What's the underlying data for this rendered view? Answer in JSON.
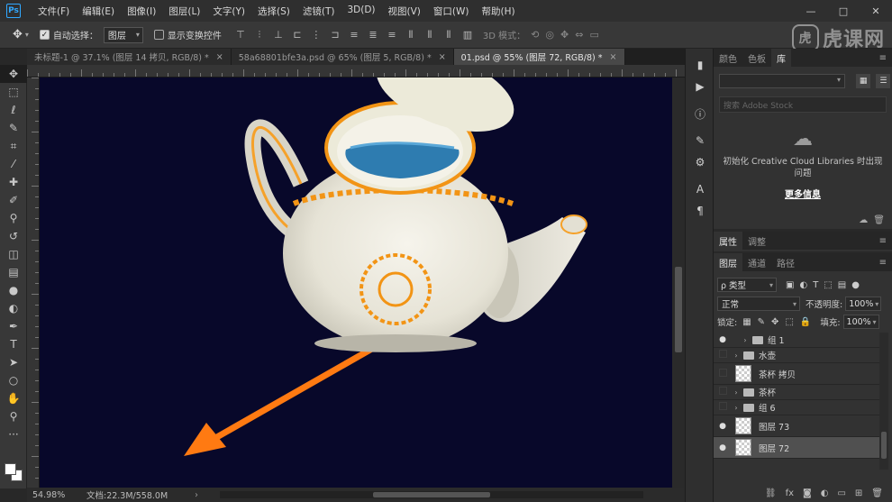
{
  "menu": {
    "logo": "Ps",
    "items": [
      "文件(F)",
      "编辑(E)",
      "图像(I)",
      "图层(L)",
      "文字(Y)",
      "选择(S)",
      "滤镜(T)",
      "3D(D)",
      "视图(V)",
      "窗口(W)",
      "帮助(H)"
    ],
    "window_buttons": [
      "—",
      "□",
      "✕"
    ]
  },
  "options": {
    "auto_select_label": "自动选择：",
    "auto_select_checked": true,
    "auto_select_target": "图层",
    "show_transform_label": "显示变换控件",
    "mode3d_label": "3D 模式："
  },
  "watermark": {
    "logo": "虎",
    "text": "虎课网"
  },
  "tabs": [
    {
      "label": "未标题-1 @ 37.1% (图层 14 拷贝, RGB/8) *",
      "close": "×",
      "active": false
    },
    {
      "label": "58a68801bfe3a.psd @ 65% (图层 5, RGB/8) *",
      "close": "×",
      "active": false
    },
    {
      "label": "01.psd @ 55% (图层 72, RGB/8) *",
      "close": "×",
      "active": true
    }
  ],
  "status": {
    "zoom": "54.98%",
    "doc": "文档:22.3M/558.0M",
    "arrow": "›"
  },
  "libraries_panel": {
    "tabs": [
      "颜色",
      "色板",
      "库"
    ],
    "active_tab": "库",
    "search_placeholder": "搜索 Adobe Stock",
    "message": "初始化 Creative Cloud Libraries 时出现问题",
    "more_info": "更多信息"
  },
  "properties_panel": {
    "tabs": [
      "属性",
      "调整"
    ],
    "active_tab": "属性"
  },
  "layers_panel": {
    "tabs": [
      "图层",
      "通道",
      "路径"
    ],
    "active_tab": "图层",
    "kind_filter": "ρ 类型",
    "blend_mode": "正常",
    "opacity_label": "不透明度:",
    "opacity_value": "100%",
    "lock_label": "锁定:",
    "fill_label": "填充:",
    "fill_value": "100%",
    "layers": [
      {
        "name": "组 1",
        "type": "group",
        "visible": true,
        "indent": 1,
        "selected": false
      },
      {
        "name": "水壶",
        "type": "group",
        "visible": false,
        "indent": 0,
        "selected": false
      },
      {
        "name": "茶杯 拷贝",
        "type": "smart",
        "visible": false,
        "indent": 0,
        "selected": false
      },
      {
        "name": "茶杯",
        "type": "group",
        "visible": false,
        "indent": 0,
        "selected": false
      },
      {
        "name": "组 6",
        "type": "group",
        "visible": false,
        "indent": 0,
        "selected": false
      },
      {
        "name": "图层 73",
        "type": "layer",
        "visible": true,
        "indent": 0,
        "selected": false
      },
      {
        "name": "图层 72",
        "type": "smart",
        "visible": true,
        "indent": 0,
        "selected": true
      }
    ]
  },
  "colors": {
    "canvas_bg": "#08082a",
    "accent_orange": "#ff7a12",
    "ps_blue": "#31a8ff"
  }
}
